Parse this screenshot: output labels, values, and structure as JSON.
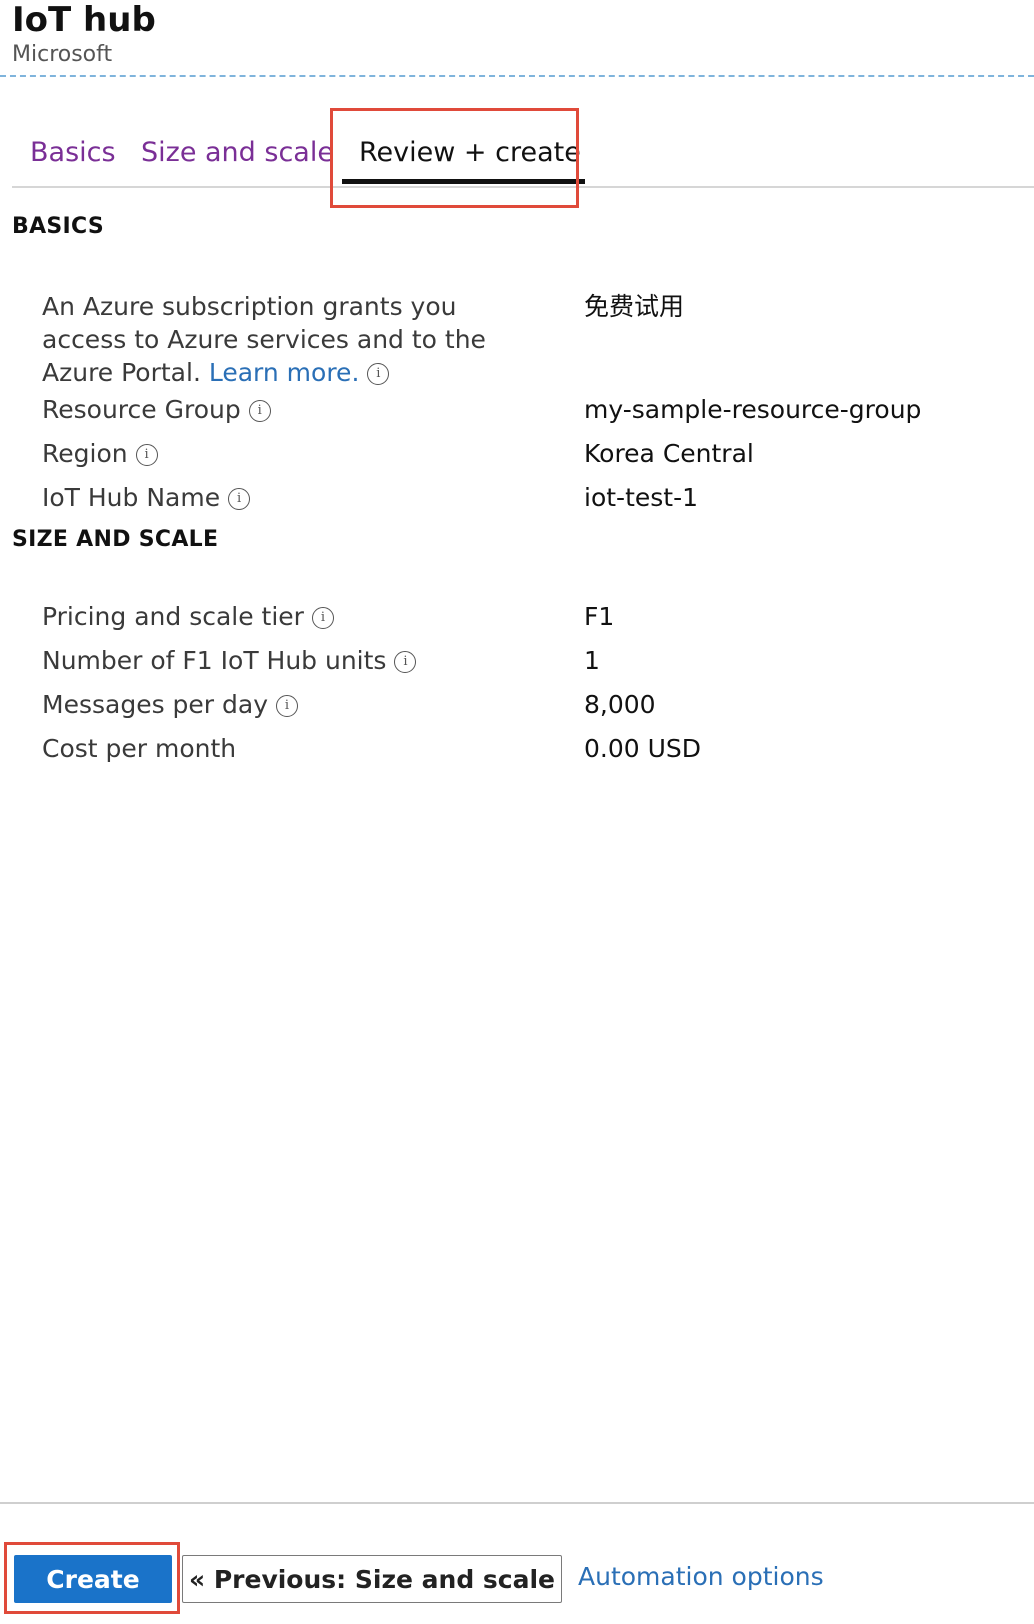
{
  "header": {
    "title": "IoT hub",
    "subtitle": "Microsoft"
  },
  "tabs": [
    {
      "label": "Basics",
      "active": false
    },
    {
      "label": "Size and scale",
      "active": false
    },
    {
      "label": "Review + create",
      "active": true
    }
  ],
  "basics": {
    "heading": "BASICS",
    "subscription": {
      "label": "An Azure subscription grants you access to Azure services and to the Azure Portal.",
      "link": "Learn more.",
      "value": "免费试用"
    },
    "resource_group": {
      "label": "Resource Group",
      "value": "my-sample-resource-group"
    },
    "region": {
      "label": "Region",
      "value": "Korea Central"
    },
    "hub_name": {
      "label": "IoT Hub Name",
      "value": "iot-test-1"
    }
  },
  "size_and_scale": {
    "heading": "SIZE AND SCALE",
    "tier": {
      "label": "Pricing and scale tier",
      "value": "F1"
    },
    "units": {
      "label": "Number of F1 IoT Hub units",
      "value": "1"
    },
    "messages": {
      "label": "Messages per day",
      "value": "8,000"
    },
    "cost": {
      "label": "Cost per month",
      "value": "0.00 USD"
    }
  },
  "footer": {
    "create_label": "Create",
    "previous_label": "« Previous: Size and scale",
    "automation_label": "Automation options"
  },
  "colors": {
    "accent_blue": "#1a73c9",
    "tab_purple": "#7a2f96",
    "highlight_red": "#e04a3a",
    "link_blue": "#2a6fb6"
  }
}
